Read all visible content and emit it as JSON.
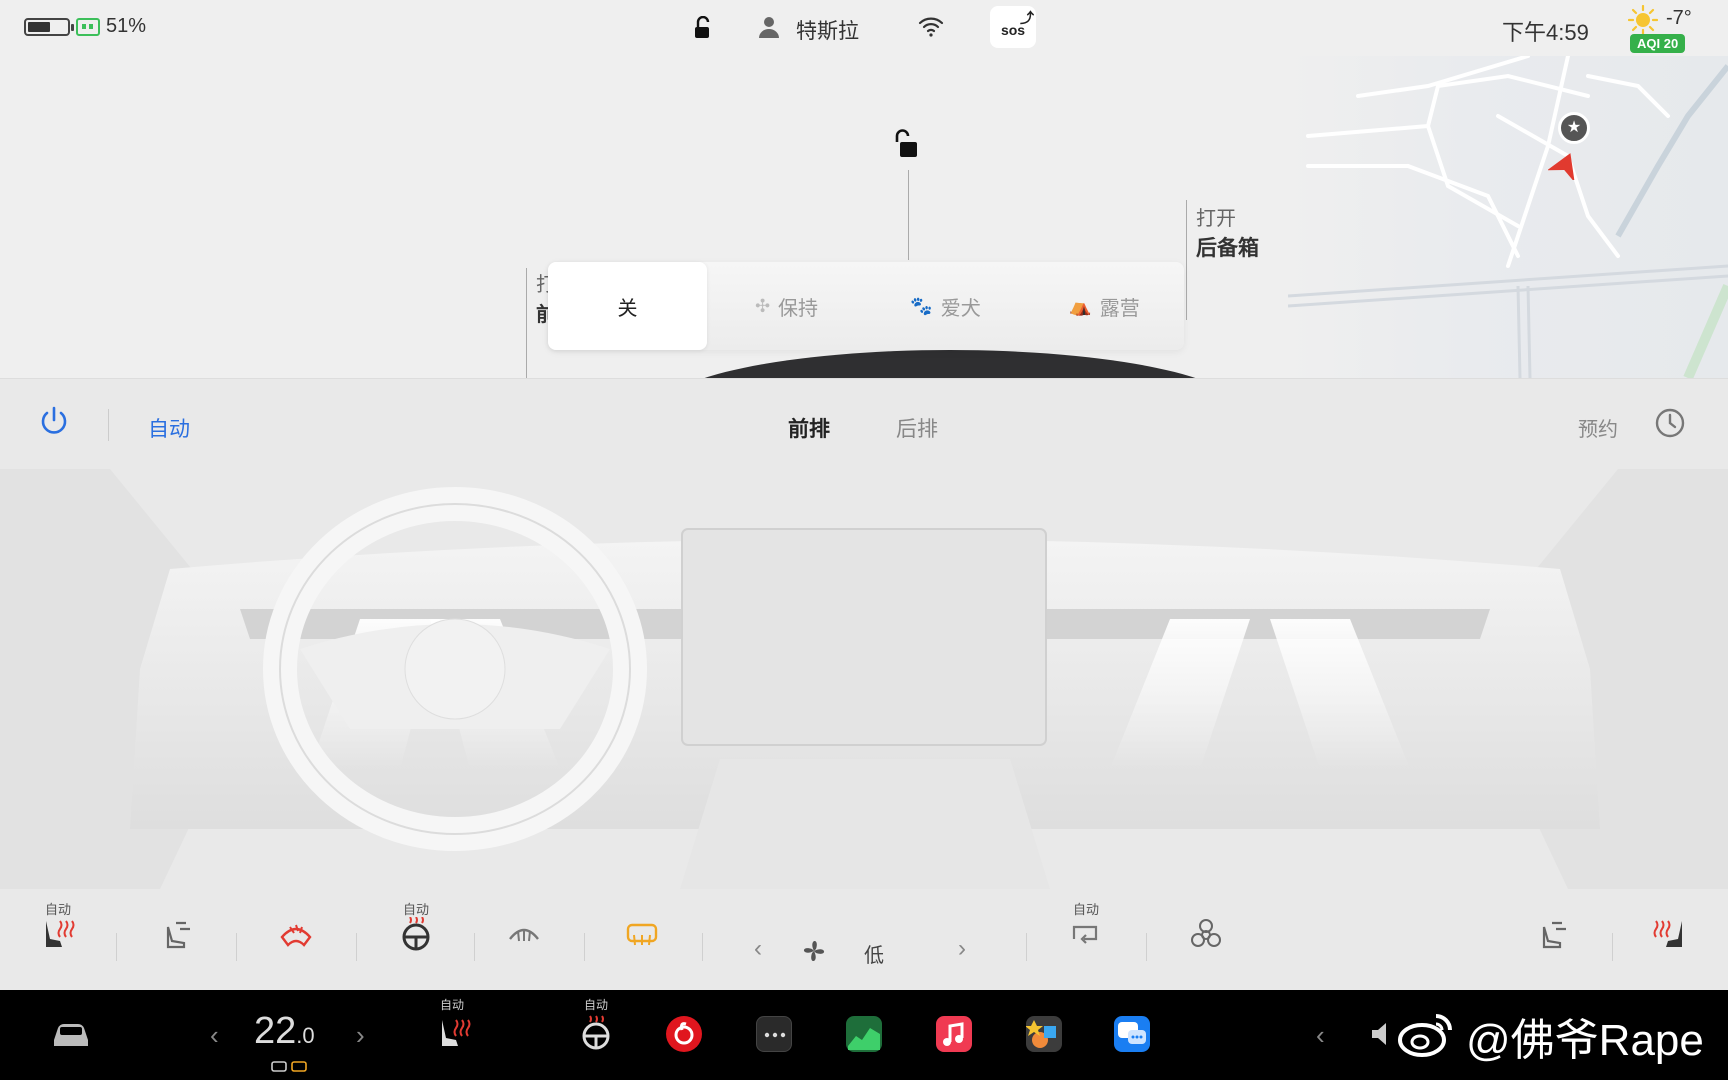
{
  "status_bar": {
    "battery_percent": "51%",
    "battery_level": 0.51,
    "user_name": "特斯拉",
    "sos_label": "sos",
    "clock": "下午4:59",
    "temperature": "-7°",
    "aqi": "AQI 20"
  },
  "vehicle": {
    "trunk_label_top": "打开",
    "trunk_label_bottom": "后备箱",
    "frunk_label_top": "打开",
    "frunk_label_bottom": "前备箱"
  },
  "modes": {
    "off": "关",
    "keep": "保持",
    "dog": "爱犬",
    "camp": "露营",
    "selected": "关"
  },
  "climate": {
    "auto_label": "自动",
    "tab_front": "前排",
    "tab_rear": "后排",
    "schedule_label": "预约",
    "seat_auto": "自动",
    "wheel_auto": "自动",
    "recirc_auto": "自动",
    "fan_speed": "低"
  },
  "dock": {
    "temperature": "22",
    "temperature_decimal": ".0",
    "seat_auto": "自动",
    "wheel_auto": "自动",
    "watermark": "@佛爷Rape"
  },
  "colors": {
    "accent_blue": "#2a6fe0",
    "heat_red": "#e23b32",
    "defrost_orange": "#f0a623",
    "aqi_green": "#35b04a"
  }
}
